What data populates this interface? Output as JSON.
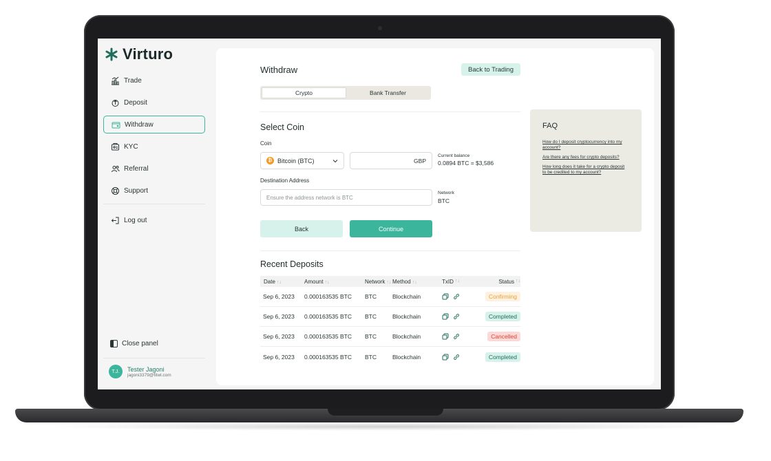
{
  "app": {
    "brand": "Virturo"
  },
  "colors": {
    "accent": "#3bb59c",
    "accent_light": "#d6f2ea",
    "confirming_bg": "#fff1df",
    "confirming_fg": "#e9a23b",
    "completed_bg": "#d6f2ea",
    "completed_fg": "#1f6e5c",
    "cancelled_bg": "#fbd9d6",
    "cancelled_fg": "#d9473b"
  },
  "sidebar": {
    "items": [
      {
        "label": "Trade",
        "icon": "chart-icon"
      },
      {
        "label": "Deposit",
        "icon": "deposit-icon"
      },
      {
        "label": "Withdraw",
        "icon": "wallet-icon"
      },
      {
        "label": "KYC",
        "icon": "id-icon"
      },
      {
        "label": "Referral",
        "icon": "users-icon"
      },
      {
        "label": "Support",
        "icon": "support-icon"
      }
    ],
    "logout": "Log out",
    "close_panel": "Close panel",
    "user": {
      "initials": "T.J.",
      "name": "Tester Jagoni",
      "email": "jagoni3379@fitwl.com"
    }
  },
  "page": {
    "title": "Withdraw",
    "back_to_trading": "Back to Trading",
    "tabs": [
      "Crypto",
      "Bank Transfer"
    ]
  },
  "form": {
    "section_title": "Select Coin",
    "coin_label": "Coin",
    "coin_value": "Bitcoin (BTC)",
    "amount_currency": "GBP",
    "balance_label": "Current balance",
    "balance_value": "0.0894 BTC = $3,586",
    "address_label": "Destination Address",
    "address_placeholder": "Ensure the address network is BTC",
    "network_label": "Network",
    "network_value": "BTC",
    "back_button": "Back",
    "continue_button": "Continue"
  },
  "recent": {
    "title": "Recent Deposits",
    "columns": [
      "Date",
      "Amount",
      "Network",
      "Method",
      "TxID",
      "Status"
    ],
    "rows": [
      {
        "date": "Sep 6, 2023",
        "amount": "0.000163535 BTC",
        "network": "BTC",
        "method": "Blockchain",
        "status": "Confirming"
      },
      {
        "date": "Sep 6, 2023",
        "amount": "0.000163535 BTC",
        "network": "BTC",
        "method": "Blockchain",
        "status": "Completed"
      },
      {
        "date": "Sep 6, 2023",
        "amount": "0.000163535 BTC",
        "network": "BTC",
        "method": "Blockchain",
        "status": "Cancelled"
      },
      {
        "date": "Sep 6, 2023",
        "amount": "0.000163535 BTC",
        "network": "BTC",
        "method": "Blockchain",
        "status": "Completed"
      }
    ]
  },
  "faq": {
    "title": "FAQ",
    "links": [
      "How do I deposit cryptocurrency into my account?",
      "Are there any fees for crypto deposits?",
      "How long does it take for a crypto deposit to be credited to my account?"
    ]
  }
}
